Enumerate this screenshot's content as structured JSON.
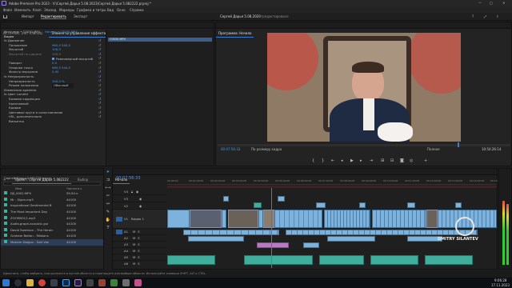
{
  "app_title": "Adobe Premiere Pro 2023 - V:\\Сергей Дарья 5.08.2023\\Сергей Дарья 5.082222.prproj *",
  "menu": [
    "Файл",
    "Изменить",
    "Клип",
    "Эпизод",
    "Маркеры",
    "Графика и титры",
    "Вид",
    "Окно",
    "Справка"
  ],
  "workspace_tabs": [
    "Импорт",
    "Редактировать",
    "Экспорт"
  ],
  "workspace_active": "Редактировать",
  "center_title": "Сергей Дарья 5.08.2023",
  "center_subtitle": "- Отредактировано",
  "source_panel": {
    "tabs": [
      "Источник: (нет клипов)",
      "Элементы управления эффектами",
      "Текст",
      "Микшер аудиоклипов: Начало"
    ],
    "source_line": "Источник • C0030.MP4",
    "source_line2": "Начало • C0030.MP4",
    "section": "Видео",
    "rows": [
      {
        "label": "fx Движение",
        "value": ""
      },
      {
        "label": "Положение",
        "value": "960,0    540,0"
      },
      {
        "label": "Масштаб",
        "value": "100,0"
      },
      {
        "label": "Масштаб по ширине",
        "value": "100,0"
      },
      {
        "label": "",
        "value": "Равномерный масштаб"
      },
      {
        "label": "Поворот",
        "value": "0,0"
      },
      {
        "label": "Опорная точка",
        "value": "960,0    540,0"
      },
      {
        "label": "Фильтр мерцания",
        "value": "0,00"
      },
      {
        "label": "fx Непрозрачность",
        "value": ""
      },
      {
        "label": "Непрозрачность",
        "value": "100,0 %"
      },
      {
        "label": "Режим наложения",
        "value": "Обычный"
      },
      {
        "label": "Изменение времени",
        "value": ""
      },
      {
        "label": "fx Цвет Lumetri",
        "value": ""
      },
      {
        "label": "Базовая коррекция",
        "value": ""
      },
      {
        "label": "Креативный",
        "value": ""
      },
      {
        "label": "Кривые",
        "value": ""
      },
      {
        "label": "Цветовые круги и сопоставление",
        "value": ""
      },
      {
        "label": "HSL, дополнительно",
        "value": ""
      },
      {
        "label": "Виньетка",
        "value": ""
      }
    ],
    "mini_clip": "C0030.MP4"
  },
  "program": {
    "tab": "Программа: Начало",
    "timecode": "00:07:56:33",
    "fit": "По размеру кадра",
    "quality": "Полное",
    "duration": "10:54:26:14"
  },
  "project": {
    "tabs": [
      "Проект: Сергей Дарья 5.082222",
      "Выбор"
    ],
    "file": "Сергей Дарья 5.082222.prproj",
    "col_name": "Имя",
    "col_rate": "Частота к",
    "items": [
      {
        "name": "DJI_0002.MP4",
        "rate": "59,94 к",
        "color": "#3fae9d"
      },
      {
        "name": "Mr - Signs.mp3",
        "rate": "44100",
        "color": "#3fae9d"
      },
      {
        "name": "Inspirational Sentimental B",
        "rate": "44100",
        "color": "#3fae9d"
      },
      {
        "name": "The Most Important Day",
        "rate": "44100",
        "color": "#3fae9d"
      },
      {
        "name": "ZOOM0012.mp3",
        "rate": "44100",
        "color": "#3fae9d"
      },
      {
        "name": "Audio.graph.acoustic.gui",
        "rate": "44100",
        "color": "#3fae9d"
      },
      {
        "name": "David Swenson - The Heroic",
        "rate": "44100",
        "color": "#3fae9d"
      },
      {
        "name": "Graham Bolton - Ribbons",
        "rate": "44100",
        "color": "#3fae9d"
      },
      {
        "name": "Maksim Dolgov - Salt Vox",
        "rate": "44100",
        "color": "#3fae9d"
      }
    ]
  },
  "timeline": {
    "tab": "Начало",
    "timecode": "00:07:56:33",
    "ruler": [
      "00:00:00",
      "00:01:00:00",
      "00:02:00:00",
      "00:03:00:00",
      "00:04:00:00",
      "00:05:00:00",
      "00:06:00:00",
      "00:07:00:00",
      "00:08:00:00",
      "00:09:00:00",
      "00:10:00:00",
      "00:11:00:00",
      "00:12:00:00",
      "00:13:00:00",
      "00:14:00:00",
      "00:15:00:00"
    ],
    "video_tracks": [
      "V4",
      "V3",
      "V2",
      "V1"
    ],
    "audio_tracks": [
      "A1",
      "A2",
      "A3",
      "A4",
      "A5",
      "A6"
    ],
    "v1_label": "Видео 1"
  },
  "watermark": "DMITRY SILANTEV",
  "status_text": "Щелкните, чтобы выбрать, или щелкните в пустой области и перетащите для выбора области. Используйте клавиши SHIFT, ALT и CTRL.",
  "clock": {
    "time": "9:06:28",
    "date": "17.11.2023"
  },
  "colors": {
    "accent": "#3a7bd5",
    "panel": "#232323",
    "audio_clip": "#7cb2dc",
    "green_clip": "#3fae9d"
  }
}
